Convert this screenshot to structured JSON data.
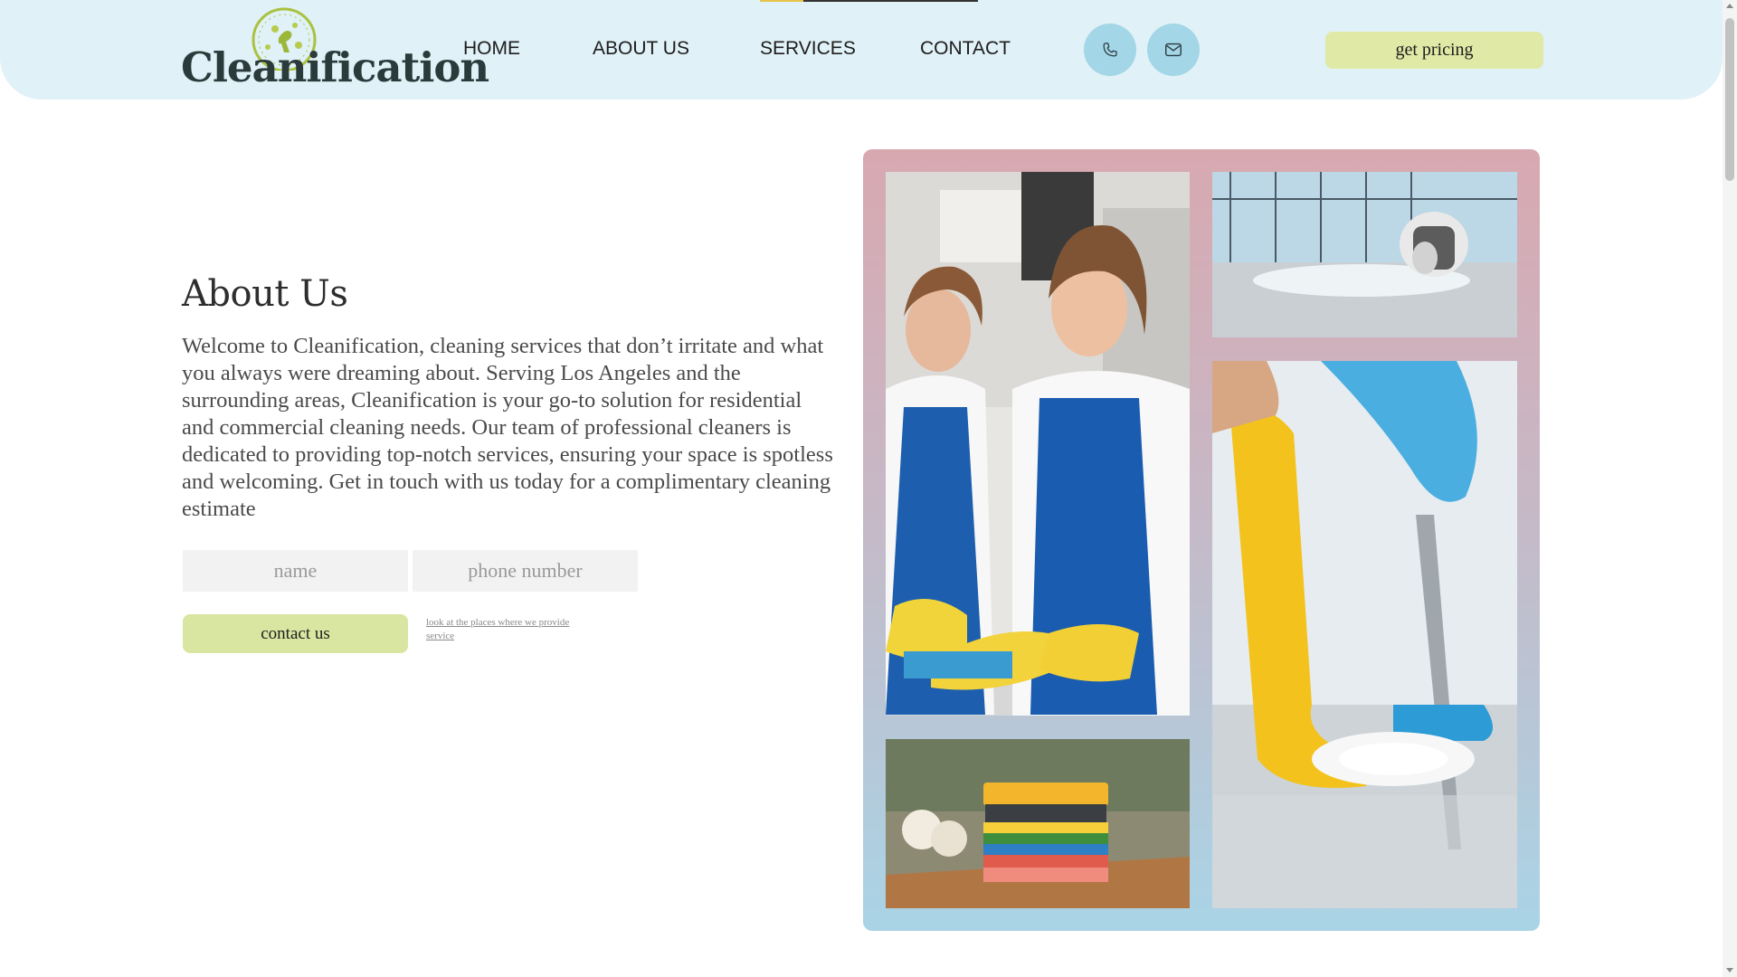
{
  "brand": {
    "name": "Cleanification"
  },
  "nav": {
    "items": [
      {
        "label": "HOME"
      },
      {
        "label": "ABOUT US"
      },
      {
        "label": "SERVICES"
      },
      {
        "label": "CONTACT"
      }
    ]
  },
  "header": {
    "phone_icon": "phone-icon",
    "mail_icon": "mail-icon",
    "pricing_label": "get pricing"
  },
  "about": {
    "title": "About Us",
    "body": "Welcome to Cleanification, cleaning services that don’t irritate and what you always were dreaming about. Serving Los Angeles and the surrounding areas, Cleanification is your go-to solution for residential and commercial cleaning needs. Our team of professional cleaners is dedicated to providing top-notch services, ensuring your space is spotless and welcoming. Get in touch with us today for a complimentary cleaning estimate"
  },
  "form": {
    "name_placeholder": "name",
    "phone_placeholder": "phone number",
    "contact_label": "contact us",
    "places_link": "look at the places where we provide service"
  },
  "colors": {
    "header_bg": "#e0f1f7",
    "accent_lime": "#e0e9a6",
    "icon_button": "#a3d6e6",
    "gallery_top": "#d8a8b0",
    "gallery_bottom": "#a9d4e6",
    "nav_indicator": "#e8c34a"
  },
  "gallery": {
    "images": [
      "two-cleaners-blue-aprons-photo",
      "office-floor-vacuum-photo",
      "mop-yellow-boots-photo",
      "colorful-sponges-photo"
    ]
  }
}
